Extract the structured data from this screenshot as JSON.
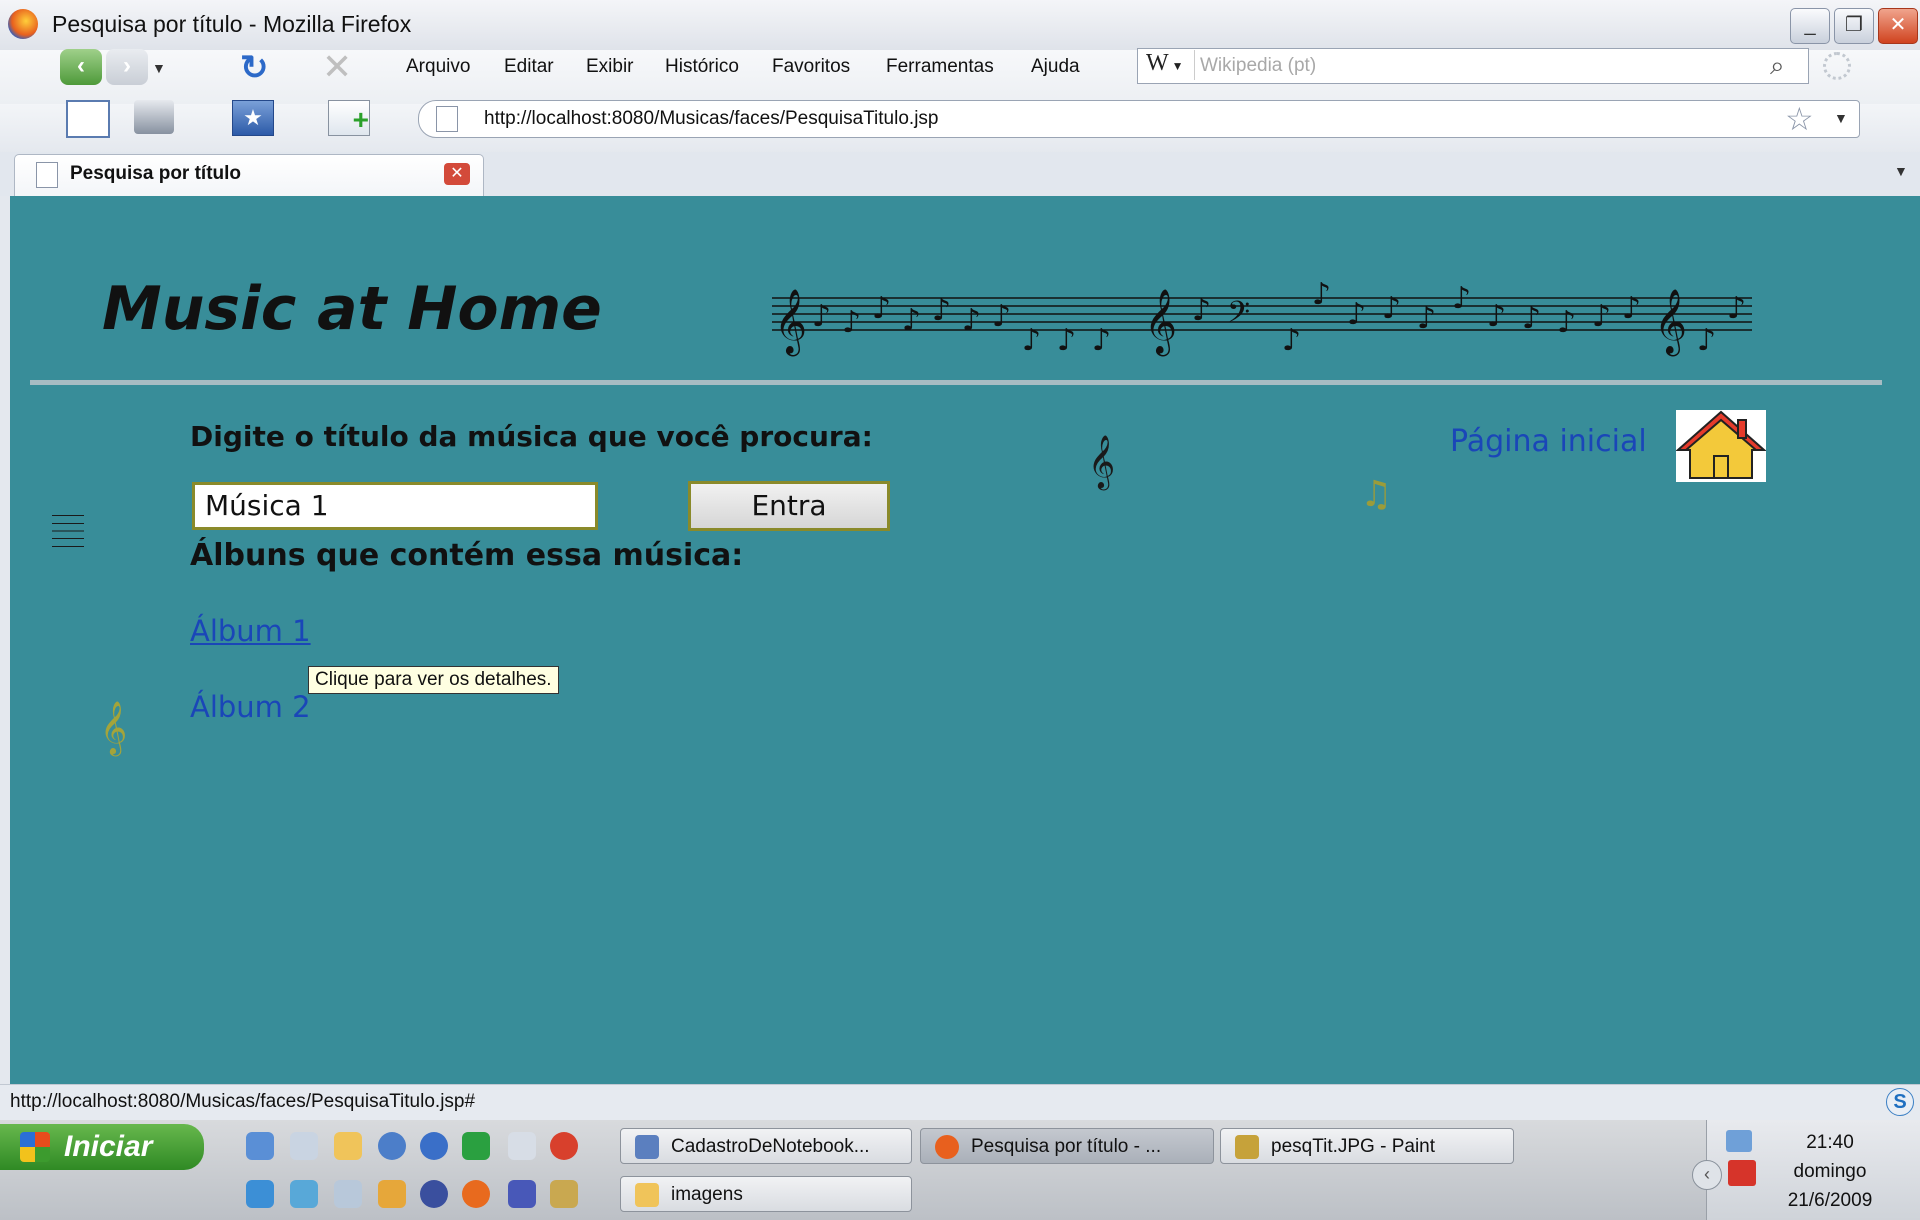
{
  "window": {
    "title": "Pesquisa por título - Mozilla Firefox"
  },
  "menu": [
    "Arquivo",
    "Editar",
    "Exibir",
    "Histórico",
    "Favoritos",
    "Ferramentas",
    "Ajuda"
  ],
  "search": {
    "engine": "W",
    "placeholder": "Wikipedia (pt)"
  },
  "url": "http://localhost:8080/Musicas/faces/PesquisaTitulo.jsp",
  "tab": {
    "label": "Pesquisa por título"
  },
  "page": {
    "site_title": "Music at Home",
    "prompt": "Digite o título da música que você procura:",
    "input_value": "Música 1",
    "submit_label": "Entra",
    "albums_heading": "Álbuns que contém essa música:",
    "albums": [
      "Álbum 1",
      "Álbum 2"
    ],
    "tooltip": "Clique para ver os detalhes.",
    "home_link": "Página inicial"
  },
  "status_text": "http://localhost:8080/Musicas/faces/PesquisaTitulo.jsp#",
  "taskbar": {
    "start_label": "Iniciar",
    "tasks": [
      "CadastroDeNotebook...",
      "Pesquisa por título - ...",
      "pesqTit.JPG - Paint",
      "imagens"
    ],
    "clock": {
      "time": "21:40",
      "day": "domingo",
      "date": "21/6/2009"
    }
  },
  "colors": {
    "page_background": "#388d99",
    "link": "#1a46b8",
    "accent_border": "#8a8a2a"
  }
}
